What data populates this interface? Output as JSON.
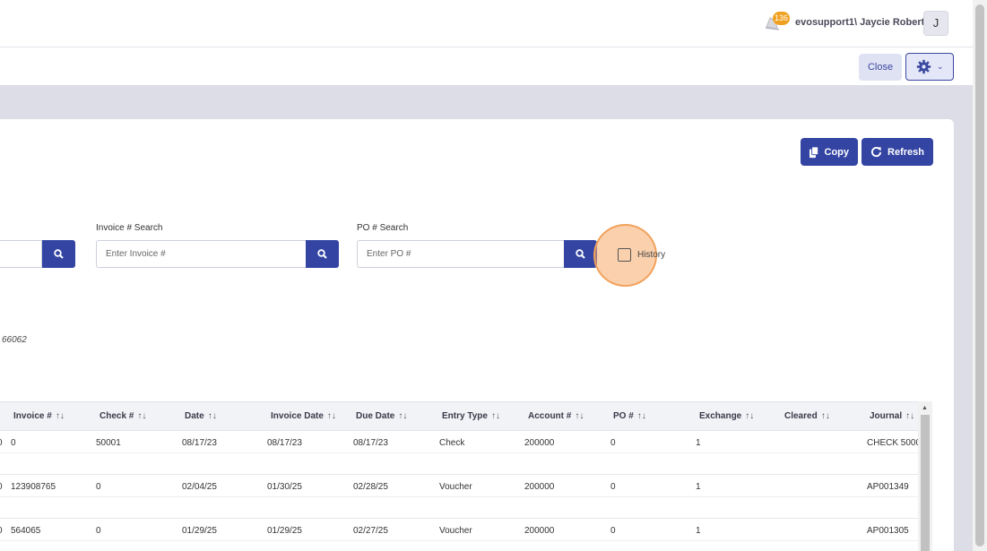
{
  "header": {
    "notification_count": "136",
    "user_name": "evosupport1\\ Jaycie Roberts",
    "avatar_initial": "J"
  },
  "toolbar": {
    "close_label": "Close"
  },
  "actions": {
    "copy_label": "Copy",
    "refresh_label": "Refresh"
  },
  "filters": {
    "invoice_label": "Invoice # Search",
    "invoice_placeholder": "Enter Invoice #",
    "po_label": "PO # Search",
    "po_placeholder": "Enter PO #",
    "history_label": "History"
  },
  "info": {
    "partial_text": "66062"
  },
  "table": {
    "headers": [
      "Invoice #",
      "Check #",
      "Date",
      "Invoice Date",
      "Due Date",
      "Entry Type",
      "Account #",
      "PO #",
      "Exchange",
      "Cleared",
      "Journal"
    ],
    "sort_glyph": "↑↓",
    "rows": [
      {
        "lead": "0",
        "invoice": "0",
        "check": "50001",
        "date": "08/17/23",
        "invoice_date": "08/17/23",
        "due_date": "08/17/23",
        "entry_type": "Check",
        "account": "200000",
        "po": "0",
        "exchange": "1",
        "cleared": "",
        "journal": "CHECK 5000"
      },
      {
        "lead": "0",
        "invoice": "123908765",
        "check": "0",
        "date": "02/04/25",
        "invoice_date": "01/30/25",
        "due_date": "02/28/25",
        "entry_type": "Voucher",
        "account": "200000",
        "po": "0",
        "exchange": "1",
        "cleared": "",
        "journal": "AP001349"
      },
      {
        "lead": "0",
        "invoice": "564065",
        "check": "0",
        "date": "01/29/25",
        "invoice_date": "01/29/25",
        "due_date": "02/27/25",
        "entry_type": "Voucher",
        "account": "200000",
        "po": "0",
        "exchange": "1",
        "cleared": "",
        "journal": "AP001305"
      }
    ]
  },
  "colors": {
    "primary": "#3344a3",
    "highlight": "#f2a25d",
    "badge": "#f0a020"
  }
}
